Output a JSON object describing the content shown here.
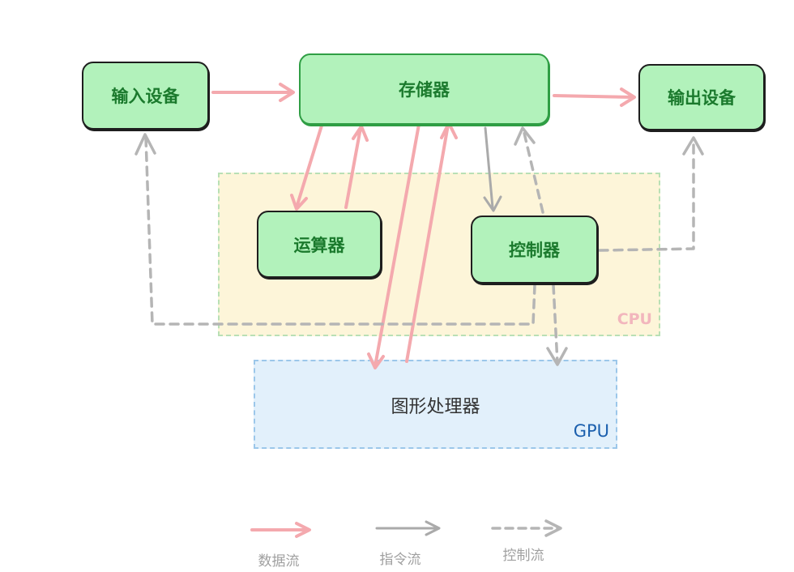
{
  "nodes": {
    "input": "输入设备",
    "memory": "存储器",
    "output": "输出设备",
    "alu": "运算器",
    "control": "控制器"
  },
  "regions": {
    "cpu": {
      "label": "CPU"
    },
    "gpu": {
      "label": "GPU",
      "title": "图形处理器"
    }
  },
  "legend": {
    "data_flow": "数据流",
    "instruction_flow": "指令流",
    "control_flow": "控制流"
  },
  "colors": {
    "node_fill": "#b2f2bb",
    "node_text": "#1b7a2d",
    "data_flow": "#f4a9ae",
    "instruction_flow": "#aaaaaa",
    "control_flow": "#b5b5b5",
    "cpu_fill": "#fdf5d9",
    "gpu_fill": "#e2f0fb"
  }
}
